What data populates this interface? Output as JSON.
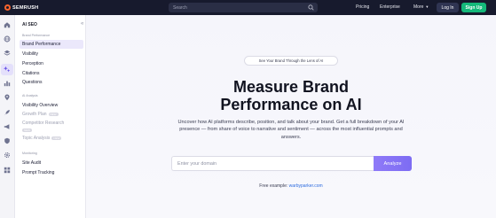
{
  "topbar": {
    "brand": "SEMRUSH",
    "search_placeholder": "Search",
    "nav": [
      "Pricing",
      "Enterprise",
      "More"
    ],
    "login_label": "Log In",
    "signup_label": "Sign Up"
  },
  "rail": {
    "icons": [
      "home-icon",
      "globe-icon",
      "layers-icon",
      "ai-sparkle-icon",
      "bar-chart-icon",
      "pin-icon",
      "rocket-icon",
      "megaphone-icon",
      "shield-icon",
      "gear-icon",
      "grid-icon"
    ],
    "active": "ai-sparkle-icon"
  },
  "sidebar": {
    "title": "AI SEO",
    "sections": [
      {
        "label": "Brand Performance",
        "items": [
          "Brand Performance",
          "Visibility",
          "Perception",
          "Citations",
          "Questions"
        ]
      },
      {
        "label": "AI Analysis",
        "items": [
          "Visibility Overview",
          "Growth Plan",
          "Competitor Research",
          "Topic Analysis"
        ]
      },
      {
        "label": "Monitoring",
        "items": [
          "Site Audit",
          "Prompt Tracking"
        ]
      }
    ],
    "active_item": "Brand Performance",
    "badge_label": "NEW"
  },
  "main": {
    "pill": "See Your Brand Through the Lens of AI",
    "headline_line1": "Measure Brand",
    "headline_line2": "Performance on AI",
    "description": "Uncover how AI platforms describe, position, and talk about your brand. Get a full breakdown of your AI presence — from share of voice to narrative and sentiment — across the most influential prompts and answers.",
    "domain_placeholder": "Enter your domain",
    "analyze_label": "Analyze",
    "example_prefix": "Free example:",
    "example_link": "warbyparker.com"
  },
  "colors": {
    "topbar": "#171a2d",
    "signup": "#14b87a",
    "accent": "#8f7af8",
    "link": "#2e6cdf",
    "logo": "#ff642d"
  }
}
